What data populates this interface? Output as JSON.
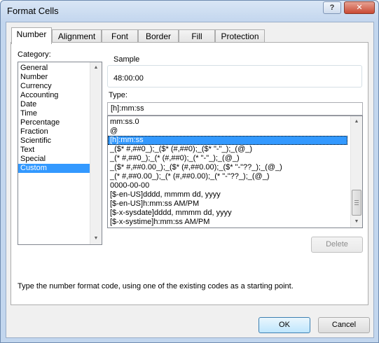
{
  "window": {
    "title": "Format Cells",
    "help_label": "?",
    "close_label": "✕"
  },
  "tabs": [
    {
      "label": "Number",
      "active": true
    },
    {
      "label": "Alignment",
      "active": false
    },
    {
      "label": "Font",
      "active": false
    },
    {
      "label": "Border",
      "active": false
    },
    {
      "label": "Fill",
      "active": false
    },
    {
      "label": "Protection",
      "active": false
    }
  ],
  "category": {
    "label": "Category:",
    "items": [
      "General",
      "Number",
      "Currency",
      "Accounting",
      "Date",
      "Time",
      "Percentage",
      "Fraction",
      "Scientific",
      "Text",
      "Special",
      "Custom"
    ],
    "selected": "Custom"
  },
  "sample": {
    "label": "Sample",
    "value": "48:00:00"
  },
  "type": {
    "label": "Type:",
    "value": "[h]:mm:ss"
  },
  "format_codes": {
    "items": [
      "mm:ss.0",
      "@",
      "[h]:mm:ss",
      "_($* #,##0_);_($* (#,##0);_($* \"-\"_);_(@_)",
      "_(* #,##0_);_(* (#,##0);_(* \"-\"_);_(@_)",
      "_($* #,##0.00_);_($* (#,##0.00);_($* \"-\"??_);_(@_)",
      "_(* #,##0.00_);_(* (#,##0.00);_(* \"-\"??_);_(@_)",
      "0000-00-00",
      "[$-en-US]dddd, mmmm dd, yyyy",
      "[$-en-US]h:mm:ss AM/PM",
      "[$-x-sysdate]dddd, mmmm dd, yyyy",
      "[$-x-systime]h:mm:ss AM/PM"
    ],
    "selected": "[h]:mm:ss"
  },
  "buttons": {
    "delete": "Delete",
    "ok": "OK",
    "cancel": "Cancel"
  },
  "description": "Type the number format code, using one of the existing codes as a starting point.",
  "icons": {
    "scroll_up": "scroll-up-arrow-icon",
    "scroll_down": "scroll-down-arrow-icon",
    "help": "help-icon",
    "close": "close-icon"
  }
}
